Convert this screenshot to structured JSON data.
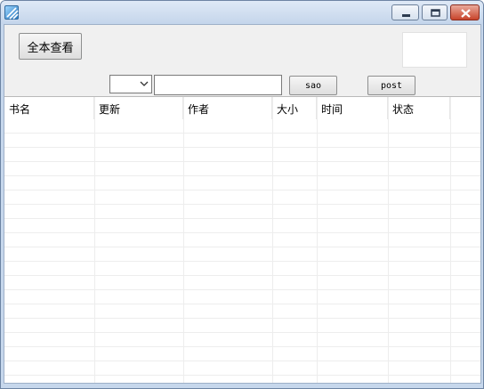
{
  "window": {
    "controls": {
      "minimize": "minimize-icon",
      "maximize": "maximize-icon",
      "close": "close-icon"
    }
  },
  "toolbar": {
    "view_all_label": "全本查看",
    "sao_label": "sao",
    "post_label": "post",
    "search_value": "",
    "select_value": ""
  },
  "table": {
    "columns": [
      "书名",
      "更新",
      "作者",
      "大小",
      "时间",
      "状态"
    ],
    "row_count": 18
  },
  "colors": {
    "title_bar": "#c6d7ec",
    "close_button": "#c8442b",
    "grid_line": "#ededed"
  }
}
